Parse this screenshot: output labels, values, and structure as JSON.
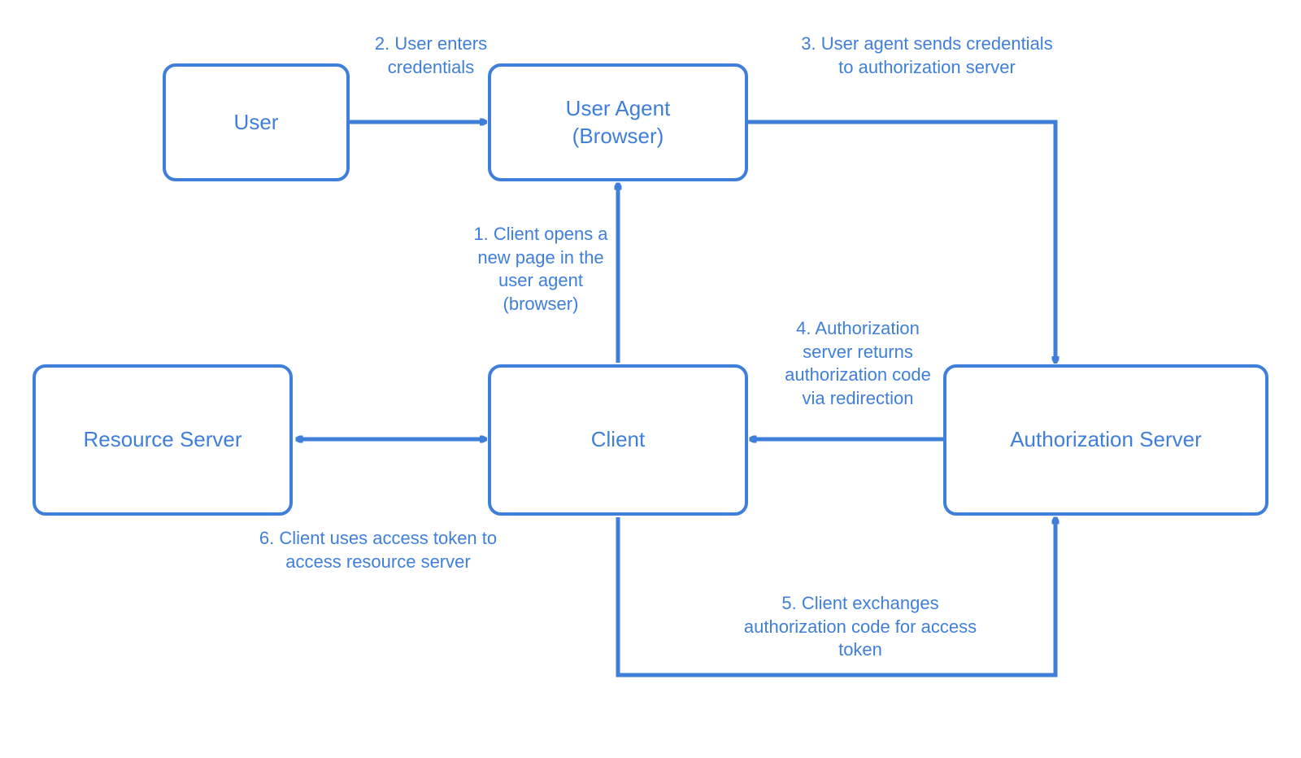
{
  "boxes": {
    "user": {
      "label": "User",
      "fontSize": 26
    },
    "userAgent": {
      "label": "User Agent\n(Browser)",
      "fontSize": 26
    },
    "client": {
      "label": "Client",
      "fontSize": 26
    },
    "resourceServer": {
      "label": "Resource Server",
      "fontSize": 26
    },
    "authServer": {
      "label": "Authorization Server",
      "fontSize": 26
    }
  },
  "labels": {
    "step1": "1. Client opens a\nnew page in the\nuser agent\n(browser)",
    "step2": "2. User enters\ncredentials",
    "step3": "3. User agent sends credentials\nto authorization server",
    "step4": "4. Authorization\nserver returns\nauthorization code\nvia redirection",
    "step5": "5. Client exchanges\nauthorization code for access\ntoken",
    "step6": "6. Client uses access token to\naccess resource server"
  },
  "colors": {
    "stroke": "#3f7fda",
    "text": "#3f7fda",
    "bg": "#ffffff"
  }
}
